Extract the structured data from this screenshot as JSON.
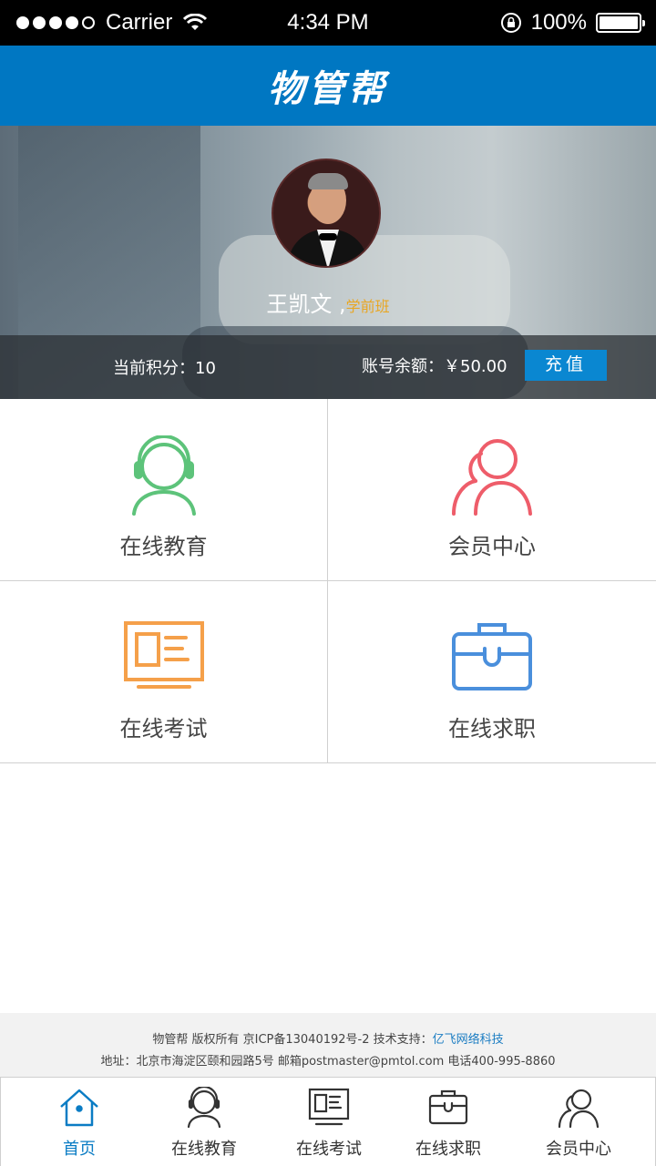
{
  "status_bar": {
    "carrier": "Carrier",
    "time": "4:34 PM",
    "battery": "100%"
  },
  "header": {
    "title": "物管帮"
  },
  "profile": {
    "name": "王凯文",
    "separator": ",",
    "role": "学前班",
    "points_label": "当前积分：10",
    "balance_label": "账号余额：￥50.00",
    "recharge_label": "充值"
  },
  "grid": {
    "items": [
      {
        "label": "在线教育",
        "icon": "headset-person-icon",
        "color": "#5dc37a"
      },
      {
        "label": "会员中心",
        "icon": "users-icon",
        "color": "#ee5d6a"
      },
      {
        "label": "在线考试",
        "icon": "exam-screen-icon",
        "color": "#f5a04a"
      },
      {
        "label": "在线求职",
        "icon": "briefcase-icon",
        "color": "#4a8fdc"
      }
    ]
  },
  "footer": {
    "line1_prefix": "物管帮 版权所有  京ICP备13040192号-2  技术支持：",
    "line1_link": "亿飞网络科技",
    "line2": "地址：北京市海淀区颐和园路5号   邮箱postmaster@pmtol.com   电话400-995-8860"
  },
  "tabbar": {
    "items": [
      {
        "label": "首页",
        "icon": "home-icon",
        "active": true
      },
      {
        "label": "在线教育",
        "icon": "headset-person-icon",
        "active": false
      },
      {
        "label": "在线考试",
        "icon": "exam-screen-icon",
        "active": false
      },
      {
        "label": "在线求职",
        "icon": "briefcase-icon",
        "active": false
      },
      {
        "label": "会员中心",
        "icon": "users-icon",
        "active": false
      }
    ]
  },
  "colors": {
    "brand": "#0077c2",
    "accent": "#e8a623",
    "active_tab": "#0a7cc4"
  }
}
